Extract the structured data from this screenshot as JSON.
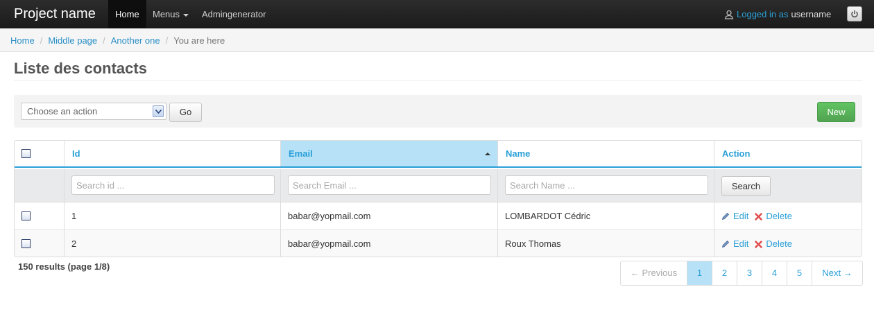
{
  "navbar": {
    "brand": "Project name",
    "items": [
      {
        "label": "Home",
        "active": true
      },
      {
        "label": "Menus",
        "dropdown": true
      },
      {
        "label": "Admingenerator"
      }
    ],
    "logged_in_label": "Logged in as",
    "username": "username",
    "user_icon": "user-icon",
    "power_icon": "power-icon"
  },
  "breadcrumb": {
    "items": [
      "Home",
      "Middle page",
      "Another one"
    ],
    "current": "You are here",
    "separator": "/"
  },
  "page": {
    "title": "Liste des contacts"
  },
  "toolbar": {
    "action_select_value": "Choose an action",
    "go_label": "Go",
    "new_label": "New"
  },
  "table": {
    "columns": [
      "Id",
      "Email",
      "Name",
      "Action"
    ],
    "sorted_column": "Email",
    "sort_direction": "asc",
    "filters": {
      "id_placeholder": "Search id ...",
      "email_placeholder": "Search Email ...",
      "name_placeholder": "Search Name ...",
      "search_label": "Search"
    },
    "rows": [
      {
        "id": "1",
        "email": "babar@yopmail.com",
        "name": "LOMBARDOT Cédric"
      },
      {
        "id": "2",
        "email": "babar@yopmail.com",
        "name": "Roux Thomas"
      }
    ],
    "edit_label": "Edit",
    "delete_label": "Delete"
  },
  "footer": {
    "results_text": "150 results (page 1/8)",
    "pagination": {
      "previous_label": "← Previous",
      "pages": [
        "1",
        "2",
        "3",
        "4",
        "5"
      ],
      "current_page": "1",
      "next_label": "Next →"
    }
  },
  "colors": {
    "accent": "#2a9fd6",
    "sorted_header_bg": "#b6e1f7",
    "new_button": "#5bb75b",
    "delete_icon": "#e04848"
  }
}
